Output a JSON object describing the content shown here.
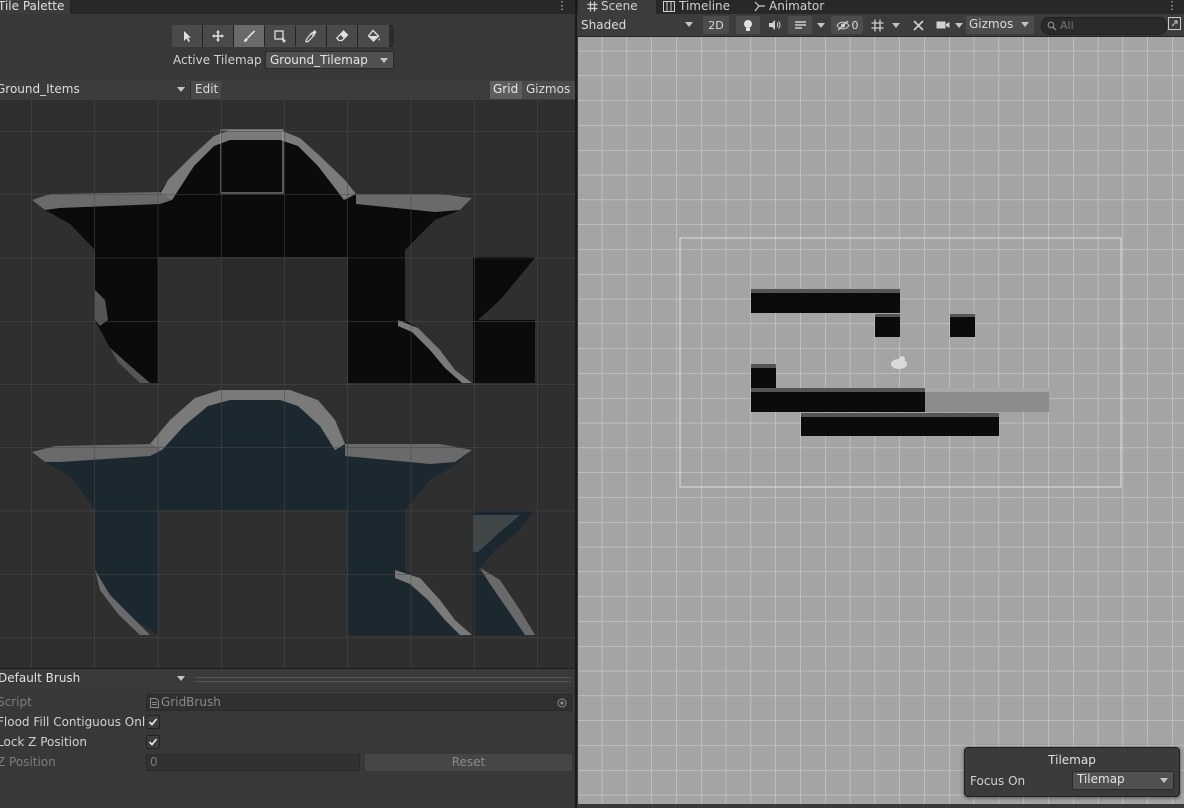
{
  "tile_palette": {
    "tab_title": "Tile Palette",
    "tools": [
      {
        "name": "select-tool-button",
        "icon": "arrow-pointer-icon"
      },
      {
        "name": "move-tool-button",
        "icon": "move-arrows-icon"
      },
      {
        "name": "paint-tool-button",
        "icon": "brush-icon",
        "active": true
      },
      {
        "name": "box-fill-tool-button",
        "icon": "box-fill-icon"
      },
      {
        "name": "picker-tool-button",
        "icon": "eyedropper-icon"
      },
      {
        "name": "eraser-tool-button",
        "icon": "eraser-icon"
      },
      {
        "name": "fill-tool-button",
        "icon": "paint-bucket-icon"
      }
    ],
    "active_tilemap_label": "Active Tilemap",
    "active_tilemap_value": "Ground_Tilemap",
    "palette_name": "Ground_Items",
    "edit_label": "Edit",
    "grid_label": "Grid",
    "gizmos_label": "Gizmos",
    "brush": {
      "selected": "Default Brush",
      "script_label": "Script",
      "script_value": "GridBrush",
      "flood_fill_label": "Flood Fill Contiguous Only",
      "flood_fill_checked": true,
      "lock_z_label": "Lock Z Position",
      "lock_z_checked": true,
      "z_position_label": "Z Position",
      "z_position_value": "0",
      "reset_label": "Reset"
    }
  },
  "scene": {
    "tabs": [
      {
        "label": "Scene",
        "icon": "hash-icon"
      },
      {
        "label": "Timeline",
        "icon": "timeline-icon"
      },
      {
        "label": "Animator",
        "icon": "animator-icon"
      }
    ],
    "shading_mode": "Shaded",
    "mode_2d_label": "2D",
    "hidden_count": "0",
    "gizmos_label": "Gizmos",
    "search_placeholder": "All",
    "overlay": {
      "title": "Tilemap",
      "focus_label": "Focus On",
      "focus_value": "Tilemap"
    }
  },
  "colors": {
    "panel_bg": "#383838",
    "palette_bg": "#2f2f2f",
    "scene_bg": "#a4a4a4",
    "dark_tile": "#0a0a0a",
    "teal_tile": "#1d2a31"
  }
}
